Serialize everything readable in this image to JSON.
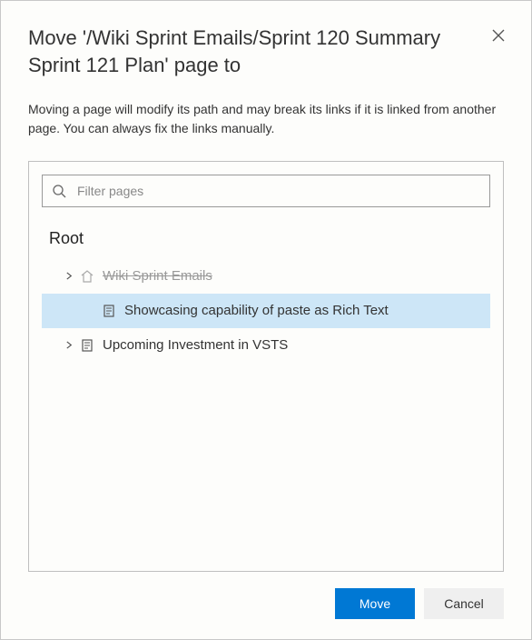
{
  "dialog": {
    "title": "Move '/Wiki Sprint Emails/Sprint 120 Summary Sprint 121 Plan' page to",
    "description": "Moving a page will modify its path and may break its links if it is linked from another page. You can always fix the links manually."
  },
  "search": {
    "placeholder": "Filter pages"
  },
  "tree": {
    "root_label": "Root",
    "items": [
      {
        "icon": "home-icon",
        "label": "Wiki Sprint Emails",
        "expandable": true,
        "disabled": true,
        "selected": false,
        "depth": 1
      },
      {
        "icon": "page-icon",
        "label": "Showcasing capability of paste as Rich Text",
        "expandable": false,
        "disabled": false,
        "selected": true,
        "depth": 2
      },
      {
        "icon": "page-icon",
        "label": "Upcoming Investment in VSTS",
        "expandable": true,
        "disabled": false,
        "selected": false,
        "depth": 1
      }
    ]
  },
  "buttons": {
    "primary": "Move",
    "secondary": "Cancel"
  }
}
